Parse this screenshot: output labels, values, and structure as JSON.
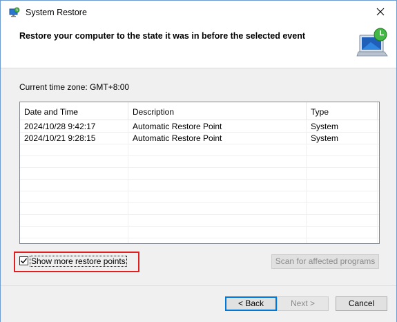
{
  "window": {
    "title": "System Restore",
    "close_symbol": "✕"
  },
  "header": {
    "title": "Restore your computer to the state it was in before the selected event",
    "icon": "system-restore-monitor-icon"
  },
  "timezone": {
    "label": "Current time zone: GMT+8:00"
  },
  "table": {
    "columns": [
      "Date and Time",
      "Description",
      "Type"
    ],
    "rows": [
      {
        "date": "2024/10/28 9:42:17",
        "description": "Automatic Restore Point",
        "type": "System"
      },
      {
        "date": "2024/10/21 9:28:15",
        "description": "Automatic Restore Point",
        "type": "System"
      }
    ]
  },
  "options": {
    "show_more_label": "Show more restore points",
    "show_more_checked": true,
    "scan_label": "Scan for affected programs"
  },
  "footer": {
    "back_label": "< Back",
    "next_label": "Next >",
    "cancel_label": "Cancel"
  },
  "colors": {
    "highlight": "#e02020",
    "focus": "#0078d7"
  }
}
